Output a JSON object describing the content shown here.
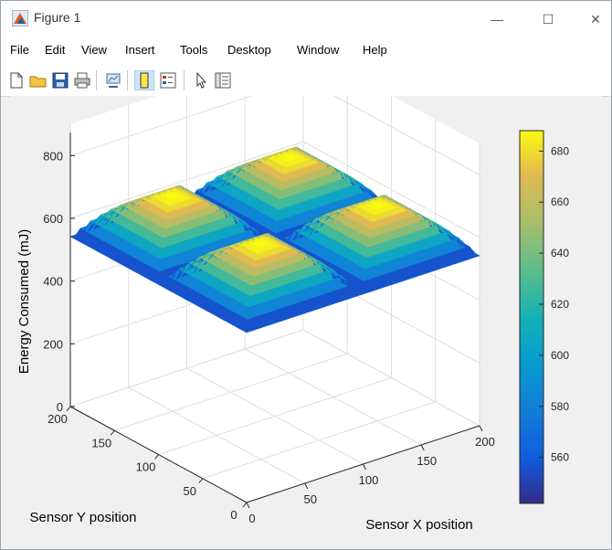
{
  "window": {
    "title": "Figure 1"
  },
  "controls": {
    "minimize": "—",
    "maximize": "☐",
    "close": "✕"
  },
  "menu": [
    "File",
    "Edit",
    "View",
    "Insert",
    "Tools",
    "Desktop",
    "Window",
    "Help"
  ],
  "toolbar_icons": [
    "new-figure-icon",
    "open-file-icon",
    "save-icon",
    "print-icon",
    "link-plot-icon",
    "colorbar-toggle-icon",
    "legend-toggle-icon",
    "pointer-icon",
    "property-editor-icon"
  ],
  "chart_data": {
    "type": "surface",
    "zlabel": "Energy Consumed (mJ)",
    "xlabel": "Sensor X position",
    "ylabel": "Sensor Y position",
    "xlim": [
      0,
      200
    ],
    "ylim": [
      0,
      200
    ],
    "zlim": [
      0,
      900
    ],
    "x_ticks": [
      0,
      50,
      100,
      150,
      200
    ],
    "y_ticks": [
      0,
      50,
      100,
      150,
      200
    ],
    "z_ticks": [
      0,
      200,
      400,
      600,
      800
    ],
    "colorbar": {
      "ticks": [
        560,
        580,
        600,
        620,
        640,
        660,
        680
      ],
      "range": [
        542,
        688
      ],
      "colormap": "parula"
    },
    "grid": true,
    "surface": {
      "description_values": "Four peaks (~688 mJ) at quadrant centres (50,50),(50,150),(150,50),(150,150); minimum ~542 mJ along the centre lines x=100 and y=100",
      "peak_value": 688,
      "min_value": 542
    }
  }
}
